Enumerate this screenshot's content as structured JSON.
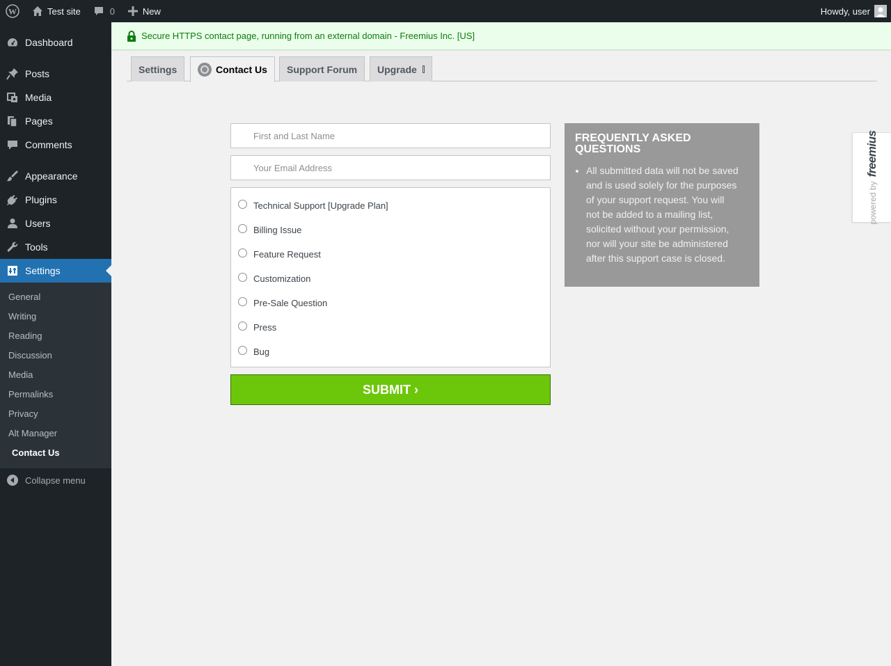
{
  "adminbar": {
    "site_name": "Test site",
    "comments_count": "0",
    "new_label": "New",
    "howdy": "Howdy, user"
  },
  "sidebar": {
    "items": [
      {
        "label": "Dashboard",
        "icon": "dashboard-icon"
      },
      {
        "label": "Posts",
        "icon": "pushpin-icon"
      },
      {
        "label": "Media",
        "icon": "media-icon"
      },
      {
        "label": "Pages",
        "icon": "pages-icon"
      },
      {
        "label": "Comments",
        "icon": "comment-icon"
      },
      {
        "label": "Appearance",
        "icon": "brush-icon"
      },
      {
        "label": "Plugins",
        "icon": "plug-icon"
      },
      {
        "label": "Users",
        "icon": "user-icon"
      },
      {
        "label": "Tools",
        "icon": "wrench-icon"
      },
      {
        "label": "Settings",
        "icon": "settings-icon"
      }
    ],
    "submenu": [
      "General",
      "Writing",
      "Reading",
      "Discussion",
      "Media",
      "Permalinks",
      "Privacy",
      "Alt Manager",
      "Contact Us"
    ],
    "collapse_label": "Collapse menu"
  },
  "notice": {
    "text": "Secure HTTPS contact page, running from an external domain - Freemius Inc. [US]"
  },
  "tabs": {
    "settings": "Settings",
    "contact": "Contact Us",
    "forum": "Support Forum",
    "upgrade": "Upgrade"
  },
  "form": {
    "name_placeholder": "First and Last Name",
    "email_placeholder": "Your Email Address",
    "options": [
      "Technical Support [Upgrade Plan]",
      "Billing Issue",
      "Feature Request",
      "Customization",
      "Pre-Sale Question",
      "Press",
      "Bug"
    ],
    "submit_label": "SUBMIT ›"
  },
  "faq": {
    "title": "FREQUENTLY ASKED QUESTIONS",
    "item": "All submitted data will not be saved and is used solely for the purposes of your support request. You will not be added to a mailing list, solicited without your permission, nor will your site be administered after this support case is closed."
  },
  "powered": {
    "prefix": "powered by",
    "brand": "freemius"
  },
  "colors": {
    "admin_dark": "#1d2327",
    "accent_blue": "#2271b1",
    "submit_green": "#6cc70a",
    "notice_green": "#0b7e0b",
    "faq_gray": "#999999"
  }
}
